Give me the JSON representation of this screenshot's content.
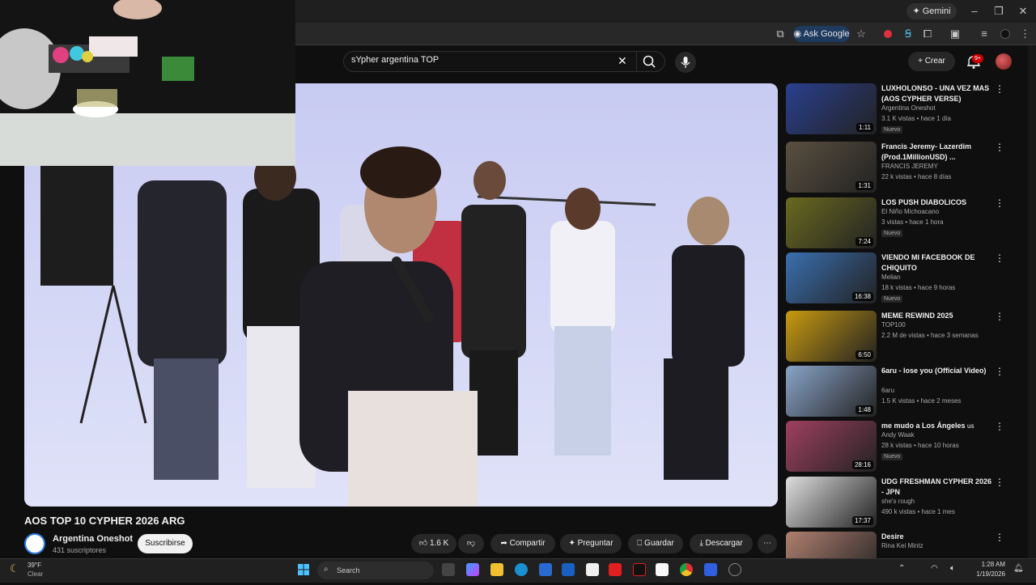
{
  "browser": {
    "gemini_label": "Gemini",
    "ask_google_label": "Ask Google"
  },
  "youtube": {
    "search_value": "sYpher argentina TOP",
    "create_label": "Crear",
    "notification_count": "9+"
  },
  "video": {
    "title": "AOS TOP 10 CYPHER 2026 ARG",
    "channel": "Argentina Oneshot",
    "subscribers": "431 suscriptores",
    "subscribe_label": "Suscribirse",
    "likes": "1.6 K",
    "share_label": "Compartir",
    "ask_label": "Preguntar",
    "save_label": "Guardar",
    "download_label": "Descargar"
  },
  "recommendations": [
    {
      "title": "LUXHOLONSO - UNA VEZ MAS (AOS CYPHER VERSE)",
      "channel": "Argentina Oneshot",
      "meta": "3.1 K vistas • hace 1 día",
      "badge": "Nuevo",
      "duration": "1:11",
      "thumb_color": "#2a3f8f"
    },
    {
      "title": "Francis Jeremy- Lazerdim (Prod.1MillionUSD) ...",
      "channel": "FRANCIS JEREMY",
      "meta": "22 k vistas • hace 8 días",
      "badge": "",
      "duration": "1:31",
      "thumb_color": "#5a5040"
    },
    {
      "title": "LOS PUSH DIABOLICOS",
      "channel": "El Niño Michoacano",
      "meta": "3 vistas • hace 1 hora",
      "badge": "Nuevo",
      "duration": "7:24",
      "thumb_color": "#6a6a20"
    },
    {
      "title": "VIENDO MI FACEBOOK DE CHIQUITO",
      "channel": "Melian",
      "meta": "18 k vistas • hace 9 horas",
      "badge": "Nuevo",
      "duration": "16:38",
      "thumb_color": "#3a6fb0"
    },
    {
      "title": "MEME REWIND 2025",
      "channel": "TOP100",
      "meta": "2.2 M de vistas • hace 3 semanas",
      "badge": "",
      "duration": "6:50",
      "thumb_color": "#c89a10"
    },
    {
      "title": "6aru - lose you (Official Video)",
      "channel": "6aru",
      "meta": "1.5 K vistas • hace 2 meses",
      "badge": "",
      "duration": "1:48",
      "thumb_color": "#8aa4c8"
    },
    {
      "title": "me mudo a Los Ángeles",
      "title_suffix": "us",
      "channel": "Andy Waak",
      "meta": "28 k vistas • hace 10 horas",
      "badge": "Nuevo",
      "duration": "28:16",
      "thumb_color": "#a04060"
    },
    {
      "title": "UDG FRESHMAN CYPHER 2026 - JPN",
      "channel": "she's rough",
      "meta": "490 k vistas • hace 1 mes",
      "badge": "",
      "duration": "17:37",
      "thumb_color": "#dedede"
    },
    {
      "title": "Desire",
      "channel": "Rina Kei Mintz",
      "meta": "",
      "badge": "",
      "duration": "",
      "thumb_color": "#b08070"
    }
  ],
  "taskbar": {
    "weather_temp": "39°F",
    "weather_desc": "Clear",
    "search_placeholder": "Search",
    "time": "1:28 AM",
    "date": "1/19/2026"
  }
}
